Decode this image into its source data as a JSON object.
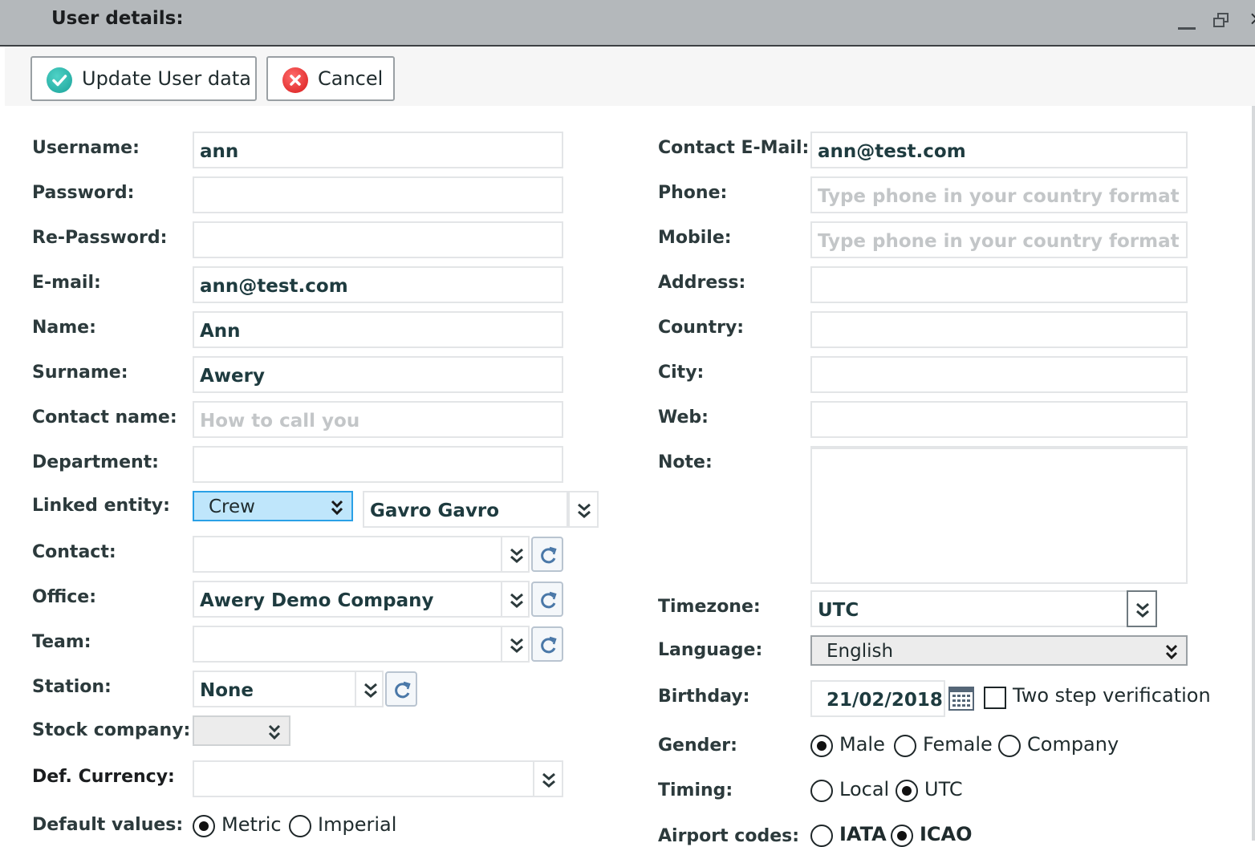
{
  "window": {
    "title": "User details:",
    "minimize_icon": "minimize-icon",
    "restore_icon": "restore-icon",
    "close_icon": "close-icon",
    "close_glyph": "×"
  },
  "toolbar": {
    "update_label": "Update User data",
    "cancel_label": "Cancel",
    "update_icon": "check-circle-icon",
    "cancel_icon": "x-circle-icon",
    "colors": {
      "ok": "#1ba39a",
      "cancel": "#d81b1b"
    }
  },
  "left": {
    "username": {
      "label": "Username:",
      "value": "ann"
    },
    "password": {
      "label": "Password:",
      "value": ""
    },
    "repassword": {
      "label": "Re-Password:",
      "value": ""
    },
    "email": {
      "label": "E-mail:",
      "value": "ann@test.com"
    },
    "name": {
      "label": "Name:",
      "value": "Ann"
    },
    "surname": {
      "label": "Surname:",
      "value": "Awery"
    },
    "contact_name": {
      "label": "Contact name:",
      "value": "",
      "placeholder": "How to call you"
    },
    "department": {
      "label": "Department:",
      "value": ""
    },
    "linked_entity": {
      "label": "Linked entity:",
      "type": "Crew",
      "value": "Gavro Gavro"
    },
    "contact": {
      "label": "Contact:",
      "value": ""
    },
    "office": {
      "label": "Office:",
      "value": "Awery Demo Company"
    },
    "team": {
      "label": "Team:",
      "value": ""
    },
    "station": {
      "label": "Station:",
      "value": "None"
    },
    "stock_company": {
      "label": "Stock company:",
      "value": ""
    },
    "def_currency": {
      "label": "Def. Currency:",
      "value": ""
    },
    "default_values": {
      "label": "Default values:",
      "options": [
        "Metric",
        "Imperial"
      ],
      "selected": "Metric"
    }
  },
  "right": {
    "contact_email": {
      "label": "Contact E-Mail:",
      "value": "ann@test.com"
    },
    "phone": {
      "label": "Phone:",
      "value": "",
      "placeholder": "Type phone in your country format"
    },
    "mobile": {
      "label": "Mobile:",
      "value": "",
      "placeholder": "Type phone in your country format"
    },
    "address": {
      "label": "Address:",
      "value": ""
    },
    "country": {
      "label": "Country:",
      "value": ""
    },
    "city": {
      "label": "City:",
      "value": ""
    },
    "web": {
      "label": "Web:",
      "value": ""
    },
    "note": {
      "label": "Note:",
      "value": ""
    },
    "timezone": {
      "label": "Timezone:",
      "value": "UTC"
    },
    "language": {
      "label": "Language:",
      "value": "English"
    },
    "birthday": {
      "label": "Birthday:",
      "value": "21/02/2018",
      "calendar_icon": "calendar-icon"
    },
    "two_step": {
      "label": "Two step verification",
      "checked": false
    },
    "gender": {
      "label": "Gender:",
      "options": [
        "Male",
        "Female",
        "Company"
      ],
      "selected": "Male"
    },
    "timing": {
      "label": "Timing:",
      "options": [
        "Local",
        "UTC"
      ],
      "selected": "UTC"
    },
    "airport_codes": {
      "label": "Airport codes:",
      "options": [
        "IATA",
        "ICAO"
      ],
      "selected": "ICAO"
    }
  },
  "colors": {
    "linked_entity_bg": "#bfe6fb",
    "linked_entity_border": "#2aa0e6",
    "language_bg": "#ececec"
  }
}
